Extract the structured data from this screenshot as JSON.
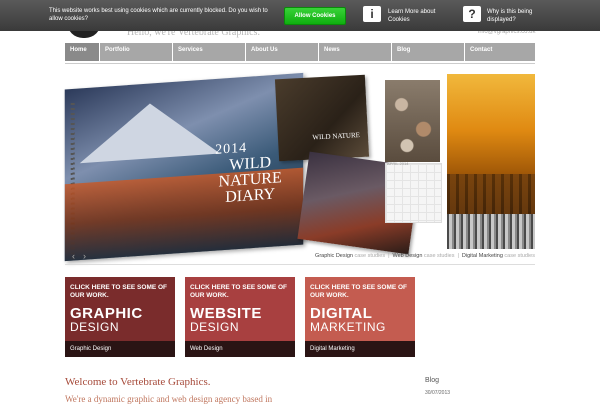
{
  "cookie": {
    "message": "This website works best using cookies which are currently blocked. Do you wish to allow cookies?",
    "allow_label": "Allow Cookies",
    "learn_more": "Learn More about Cookies",
    "why_label": "Why is this being displayed?",
    "allow_color": "#1fbe1f"
  },
  "header": {
    "tagline": "Hello, we're Vertebrate Graphics.",
    "email": "info@vgraphics.co.uk"
  },
  "nav": {
    "items": [
      {
        "label": "Home"
      },
      {
        "label": "Portfolio"
      },
      {
        "label": "Services"
      },
      {
        "label": "About Us"
      },
      {
        "label": "News"
      },
      {
        "label": "Blog"
      },
      {
        "label": "Contact"
      }
    ]
  },
  "hero": {
    "diary_year": "2014",
    "diary_title": "WILD NATURE DIARY",
    "otter_title": "WILD NATURE",
    "calendar_label": "APRIL 2014",
    "captions": [
      {
        "label": "Graphic Design",
        "suffix": "case studies"
      },
      {
        "label": "Web Design",
        "suffix": "case studies"
      },
      {
        "label": "Digital Marketing",
        "suffix": "case studies"
      }
    ],
    "prev_label": "‹",
    "next_label": "›"
  },
  "boxes": [
    {
      "click": "CLICK HERE TO SEE SOME OF OUR WORK.",
      "big": "GRAPHIC",
      "small": "DESIGN",
      "footer": "Graphic Design",
      "color": "#7a2c2c"
    },
    {
      "click": "CLICK HERE TO SEE SOME OF OUR WORK.",
      "big": "WEBSITE",
      "small": "DESIGN",
      "footer": "Web Design",
      "color": "#a84040"
    },
    {
      "click": "CLICK HERE TO SEE SOME OF OUR WORK.",
      "big": "DIGITAL",
      "small": "MARKETING",
      "footer": "Digital Marketing",
      "color": "#c45c50"
    }
  ],
  "content": {
    "welcome": "Welcome to Vertebrate Graphics.",
    "intro": "We're a dynamic graphic and web design agency based in"
  },
  "blog": {
    "title": "Blog",
    "date": "30/07/2013"
  }
}
